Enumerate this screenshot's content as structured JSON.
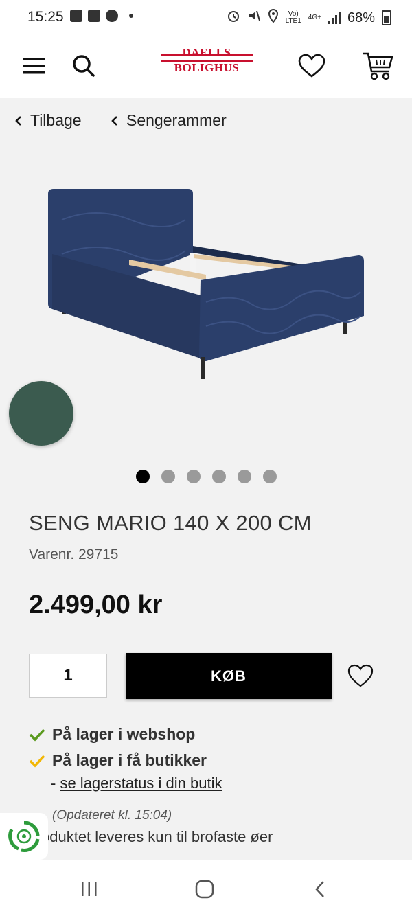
{
  "status_bar": {
    "time": "15:25",
    "network_label_top": "Vo)",
    "network_label_bottom": "LTE1",
    "network_type": "4G+",
    "battery": "68%"
  },
  "header": {
    "logo_line1": "DAELLS",
    "logo_line2": "BOLIGHUS",
    "icons": [
      "menu-icon",
      "search-icon",
      "heart-icon",
      "cart-icon"
    ]
  },
  "breadcrumb": {
    "back_label": "Tilbage",
    "category_label": "Sengerammer"
  },
  "product": {
    "title": "SENG MARIO 140 X 200 CM",
    "sku": "Varenr. 29715",
    "price": "2.499,00 kr",
    "swatch_color": "#3b5b4f",
    "bed_color": "#2b3f6b",
    "gallery_count": 6,
    "gallery_active": 1
  },
  "purchase": {
    "quantity": "1",
    "buy_label": "KØB"
  },
  "availability": {
    "webshop": "På lager i webshop",
    "webshop_check_color": "#5a9a1e",
    "stores": "På lager i få butikker",
    "stores_check_color": "#f2b705",
    "link_prefix": "-",
    "store_link": "se lagerstatus i din butik",
    "updated": "(Opdateret kl. 15:04)",
    "delivery_note": "oduktet leveres kun til brofaste øer"
  }
}
